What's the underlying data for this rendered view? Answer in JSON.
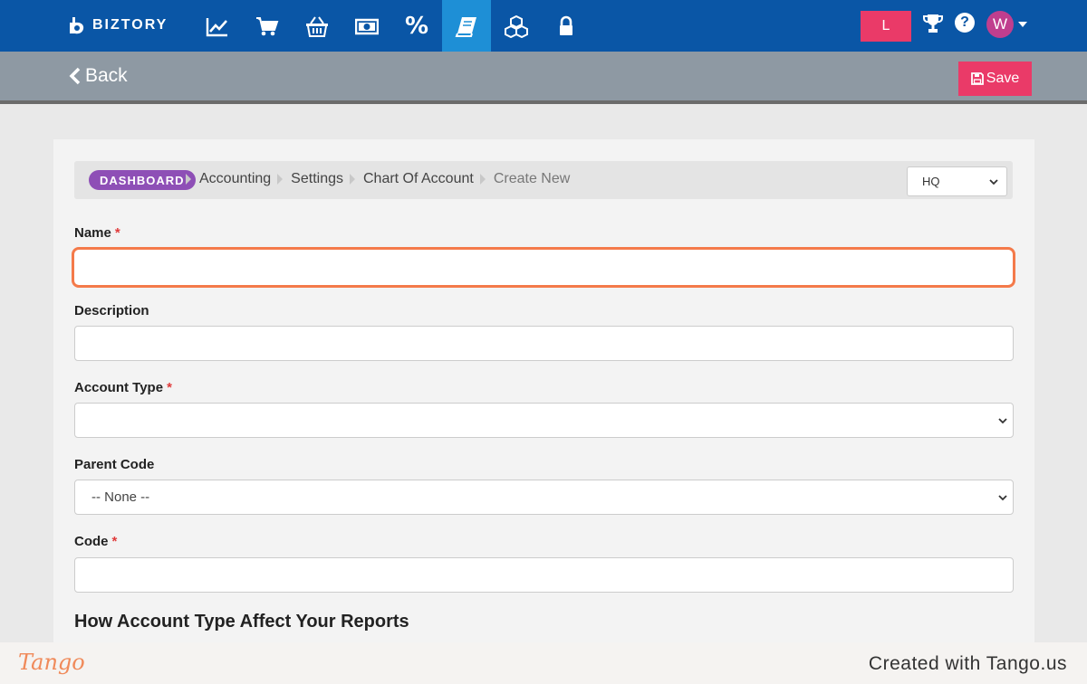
{
  "brand": {
    "name": "BIZTORY",
    "logo_icon": "biztory-logo-icon"
  },
  "nav": {
    "icons": [
      {
        "name": "chart-line-icon"
      },
      {
        "name": "shopping-cart-icon"
      },
      {
        "name": "basket-icon"
      },
      {
        "name": "money-bill-icon"
      },
      {
        "name": "percent-icon",
        "glyph": "%"
      },
      {
        "name": "book-icon",
        "active": true
      },
      {
        "name": "cubes-icon"
      },
      {
        "name": "lock-icon"
      }
    ],
    "user_initial_button": "L",
    "avatar_initial": "W",
    "help_glyph": "?"
  },
  "subbar": {
    "back_label": "Back",
    "save_label": "Save"
  },
  "breadcrumb": {
    "dashboard": "DASHBOARD",
    "items": [
      "Accounting",
      "Settings",
      "Chart Of Account",
      "Create New"
    ]
  },
  "branch_select": {
    "value": "HQ"
  },
  "form": {
    "name_label": "Name",
    "name_value": "",
    "description_label": "Description",
    "description_value": "",
    "account_type_label": "Account Type",
    "account_type_value": "",
    "parent_code_label": "Parent Code",
    "parent_code_value": "-- None --",
    "code_label": "Code",
    "code_value": "",
    "required_marker": "*"
  },
  "section_title": "How Account Type Affect Your Reports",
  "footer": {
    "logo_text": "Tango",
    "created_text": "Created with Tango.us"
  },
  "colors": {
    "nav_bg": "#0a56a6",
    "nav_active": "#1e8fd6",
    "accent_pink": "#ea3a68",
    "dashboard_badge": "#8e4fb6",
    "focus_outline": "#f47a4a",
    "subbar_bg": "#8e99a3"
  }
}
